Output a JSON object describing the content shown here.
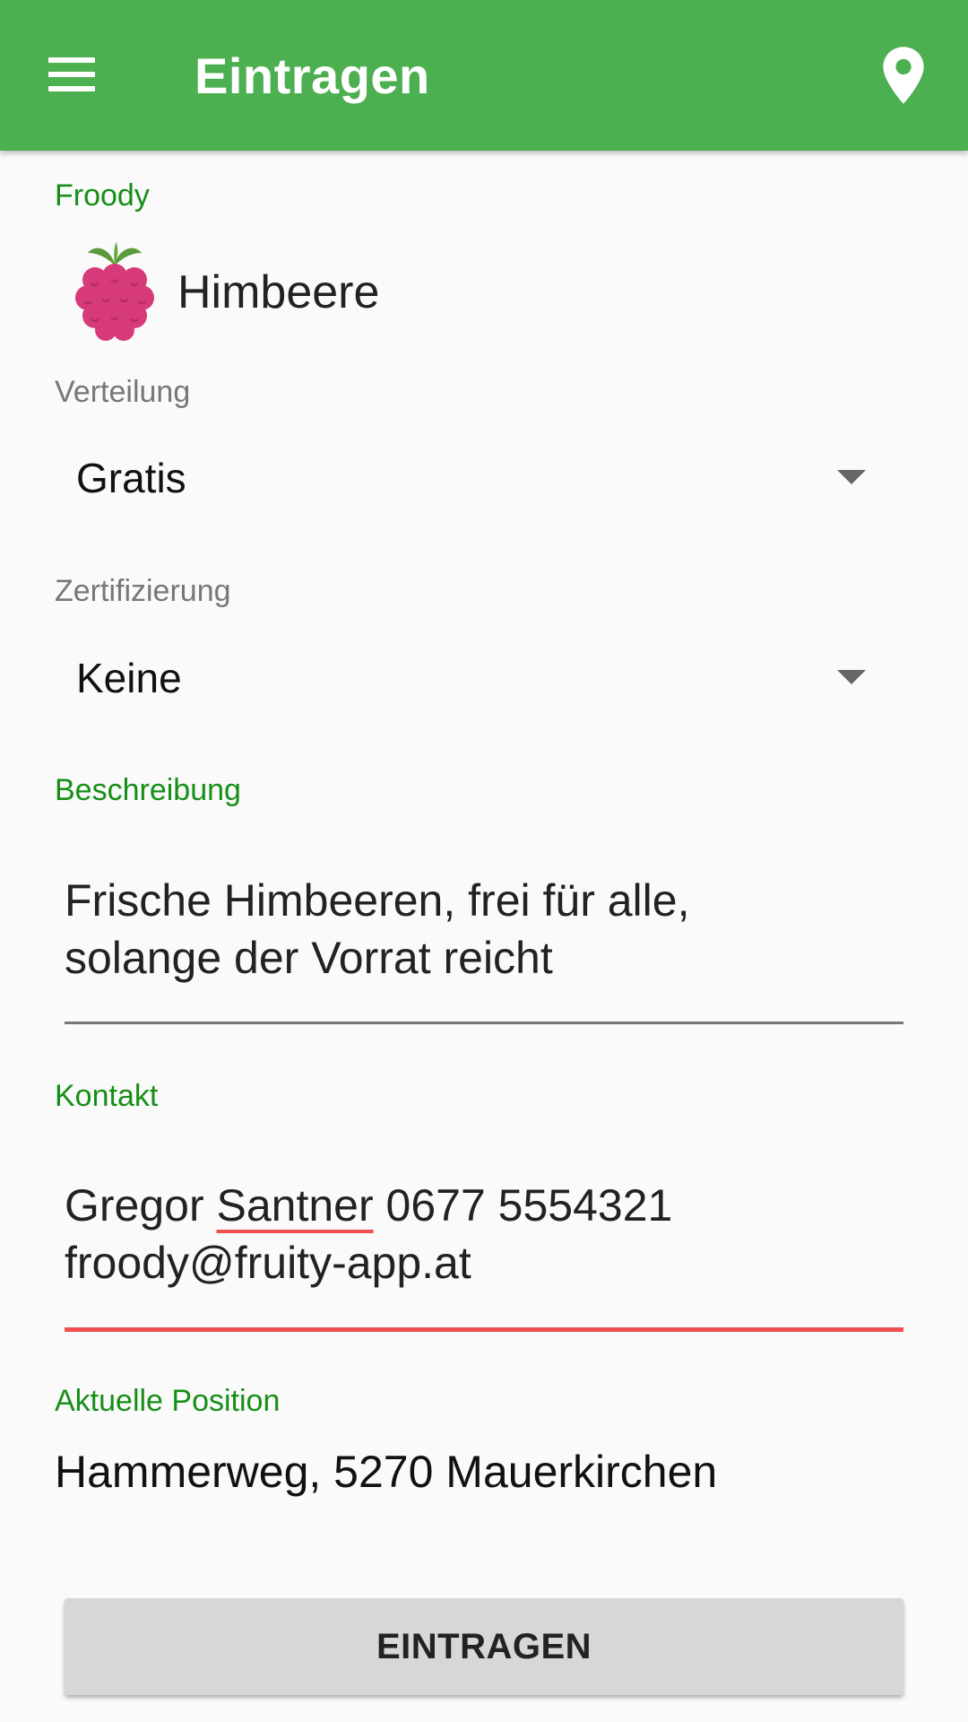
{
  "appbar": {
    "title": "Eintragen",
    "menu_icon": "hamburger-menu-icon",
    "location_icon": "map-pin-icon",
    "color": "#4caf50"
  },
  "form": {
    "froody_label": "Froody",
    "fruit": {
      "name": "Himbeere",
      "icon": "raspberry-icon"
    },
    "distribution": {
      "label": "Verteilung",
      "value": "Gratis"
    },
    "certification": {
      "label": "Zertifizierung",
      "value": "Keine"
    },
    "description": {
      "label": "Beschreibung",
      "line1": "Frische Himbeeren, frei für alle,",
      "line2": "solange der Vorrat reicht"
    },
    "contact": {
      "label": "Kontakt",
      "line1_a": "Gregor ",
      "line1_b": "Santner",
      "line1_c": " 0677 5554321",
      "line2": "froody@fruity-app.at"
    },
    "position": {
      "label": "Aktuelle Position",
      "value": "Hammerweg, 5270 Mauerkirchen"
    },
    "submit_label": "EINTRAGEN"
  },
  "colors": {
    "label_green": "#168f16",
    "error_red": "#f05050",
    "button_bg": "#d6d7d7"
  }
}
